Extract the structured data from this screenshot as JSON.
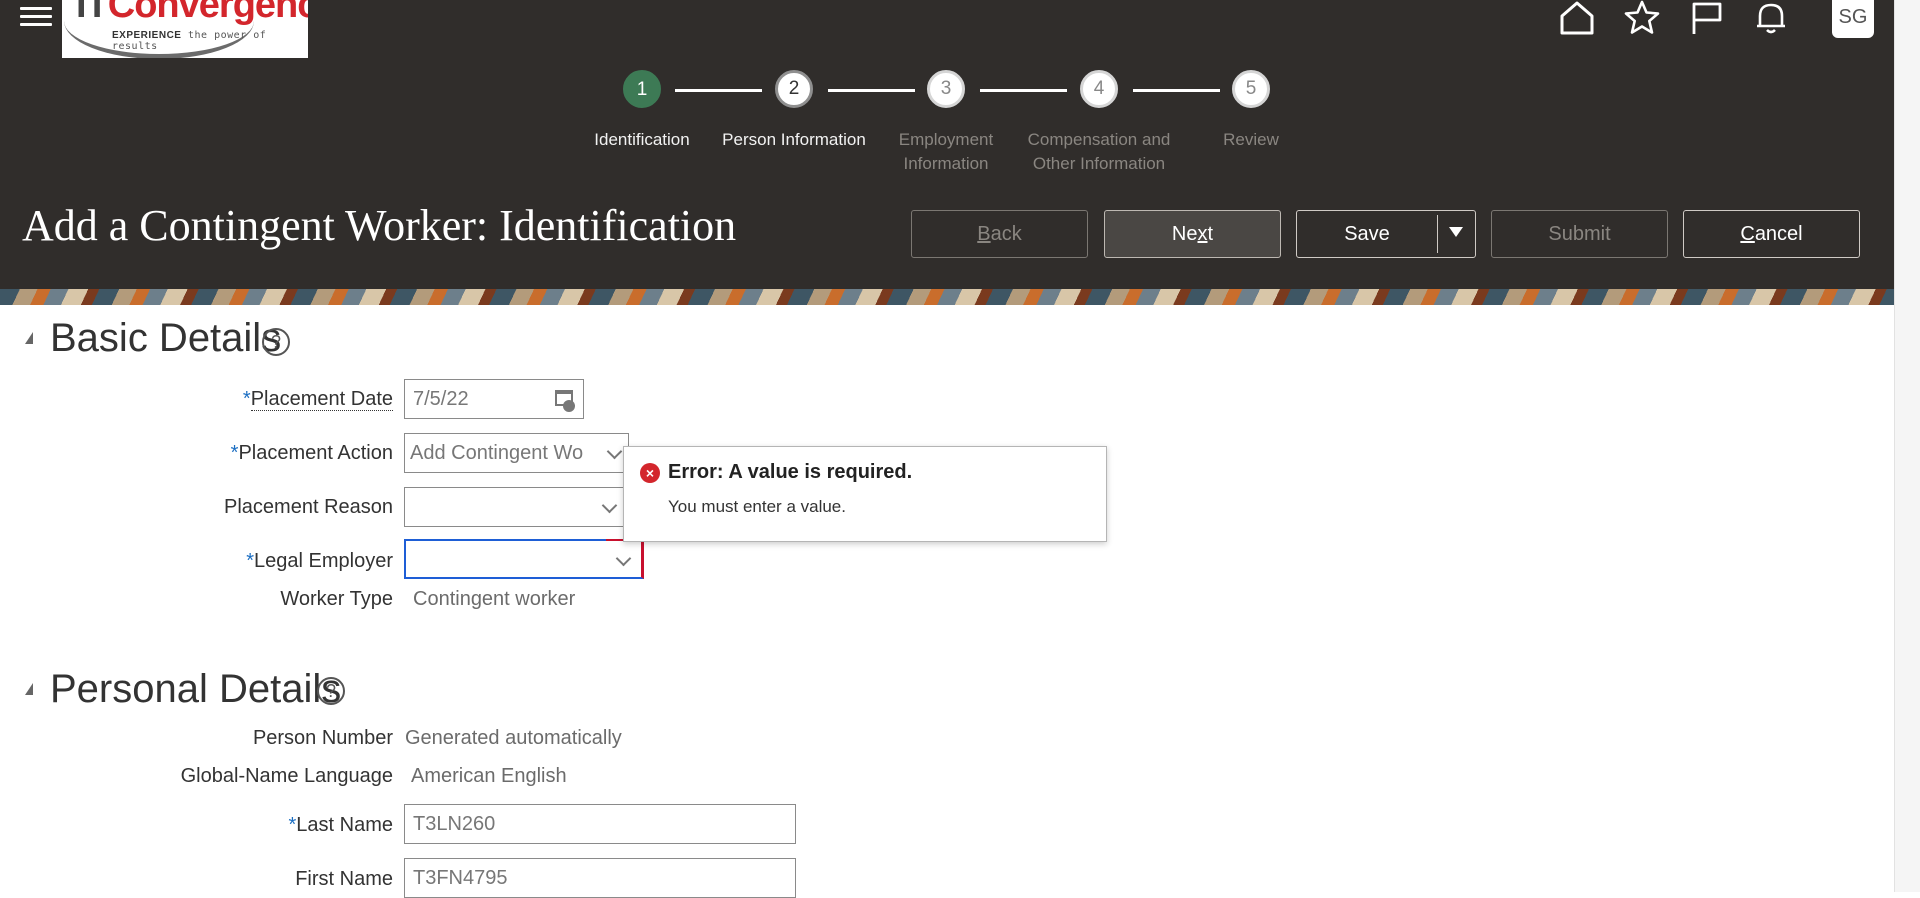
{
  "header": {
    "logo": {
      "brand_it": "IT",
      "brand_rest": "Convergence",
      "tagline_bold": "EXPERIENCE",
      "tagline_rest": " the power of results"
    },
    "icons": [
      "home-icon",
      "star-icon",
      "flag-icon",
      "bell-icon"
    ],
    "user_initials": "SG"
  },
  "train": {
    "steps": [
      {
        "number": "1",
        "label_line1": "Identification",
        "label_line2": "",
        "state": "done"
      },
      {
        "number": "2",
        "label_line1": "Person Information",
        "label_line2": "",
        "state": "current"
      },
      {
        "number": "3",
        "label_line1": "Employment",
        "label_line2": "Information",
        "state": "todo"
      },
      {
        "number": "4",
        "label_line1": "Compensation and",
        "label_line2": "Other Information",
        "state": "todo"
      },
      {
        "number": "5",
        "label_line1": "Review",
        "label_line2": "",
        "state": "todo"
      }
    ],
    "colors": {
      "done": "#3d7a55"
    }
  },
  "page": {
    "title": "Add a Contingent Worker: Identification",
    "buttons": {
      "back": {
        "mnemonic": "B",
        "rest": "ack",
        "enabled": false
      },
      "next": {
        "pre": "Ne",
        "mnemonic": "x",
        "rest": "t",
        "enabled": true
      },
      "save": {
        "label": "Save",
        "enabled": true
      },
      "submit": {
        "label": "Submit",
        "enabled": false
      },
      "cancel": {
        "mnemonic": "C",
        "rest": "ancel",
        "enabled": true
      }
    }
  },
  "basic_details": {
    "title": "Basic Details",
    "placement_date": {
      "label": "Placement Date",
      "required": "*",
      "value": "7/5/22"
    },
    "placement_action": {
      "label": "Placement Action",
      "required": "*",
      "value": "Add Contingent Wo"
    },
    "placement_reason": {
      "label": "Placement Reason",
      "value": ""
    },
    "legal_employer": {
      "label": "Legal Employer",
      "required": "*",
      "value": ""
    },
    "worker_type": {
      "label": "Worker Type",
      "value": "Contingent worker"
    }
  },
  "error_note": {
    "title": "Error: A value is required.",
    "message": "You must enter a value."
  },
  "personal_details": {
    "title": "Personal Details",
    "person_number": {
      "label": "Person Number",
      "value": "Generated automatically"
    },
    "global_name_language": {
      "label": "Global-Name Language",
      "value": "American English"
    },
    "last_name": {
      "label": "Last Name",
      "required": "*",
      "value": "T3LN260"
    },
    "first_name": {
      "label": "First Name",
      "value": "T3FN4795"
    }
  }
}
